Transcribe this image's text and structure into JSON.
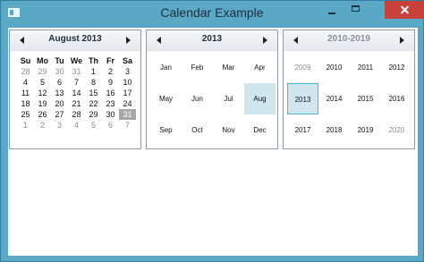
{
  "window": {
    "title": "Calendar Example",
    "buttons": {
      "minimize": "",
      "maximize": "",
      "close": ""
    }
  },
  "calendars": [
    {
      "title": "August 2013",
      "day_headers": [
        "Su",
        "Mo",
        "Tu",
        "We",
        "Th",
        "Fr",
        "Sa"
      ],
      "weeks": [
        [
          "28",
          "29",
          "30",
          "31",
          "1",
          "2",
          "3"
        ],
        [
          "4",
          "5",
          "6",
          "7",
          "8",
          "9",
          "10"
        ],
        [
          "11",
          "12",
          "13",
          "14",
          "15",
          "16",
          "17"
        ],
        [
          "18",
          "19",
          "20",
          "21",
          "22",
          "23",
          "24"
        ],
        [
          "25",
          "26",
          "27",
          "28",
          "29",
          "30",
          "31"
        ],
        [
          "1",
          "2",
          "3",
          "4",
          "5",
          "6",
          "7"
        ]
      ],
      "dim_cells": [
        "0-0",
        "0-1",
        "0-2",
        "0-3",
        "5-0",
        "5-1",
        "5-2",
        "5-3",
        "5-4",
        "5-5",
        "5-6"
      ],
      "selected_cell": "4-6"
    },
    {
      "title": "2013",
      "months": [
        [
          "Jan",
          "Feb",
          "Mar",
          "Apr"
        ],
        [
          "May",
          "Jun",
          "Jul",
          "Aug"
        ],
        [
          "Sep",
          "Oct",
          "Nov",
          "Dec"
        ]
      ],
      "highlight": "1-3"
    },
    {
      "title": "2010-2019",
      "years": [
        [
          "2009",
          "2010",
          "2011",
          "2012"
        ],
        [
          "2013",
          "2014",
          "2015",
          "2016"
        ],
        [
          "2017",
          "2018",
          "2019",
          "2020"
        ]
      ],
      "dim_years": [
        "0-0",
        "2-3"
      ],
      "highlight": "1-0"
    }
  ],
  "colors": {
    "titlebar": "#5aa7c6",
    "close": "#c7403a",
    "selected_day": "#a7a7a7",
    "highlight": "#cfe6ee"
  }
}
